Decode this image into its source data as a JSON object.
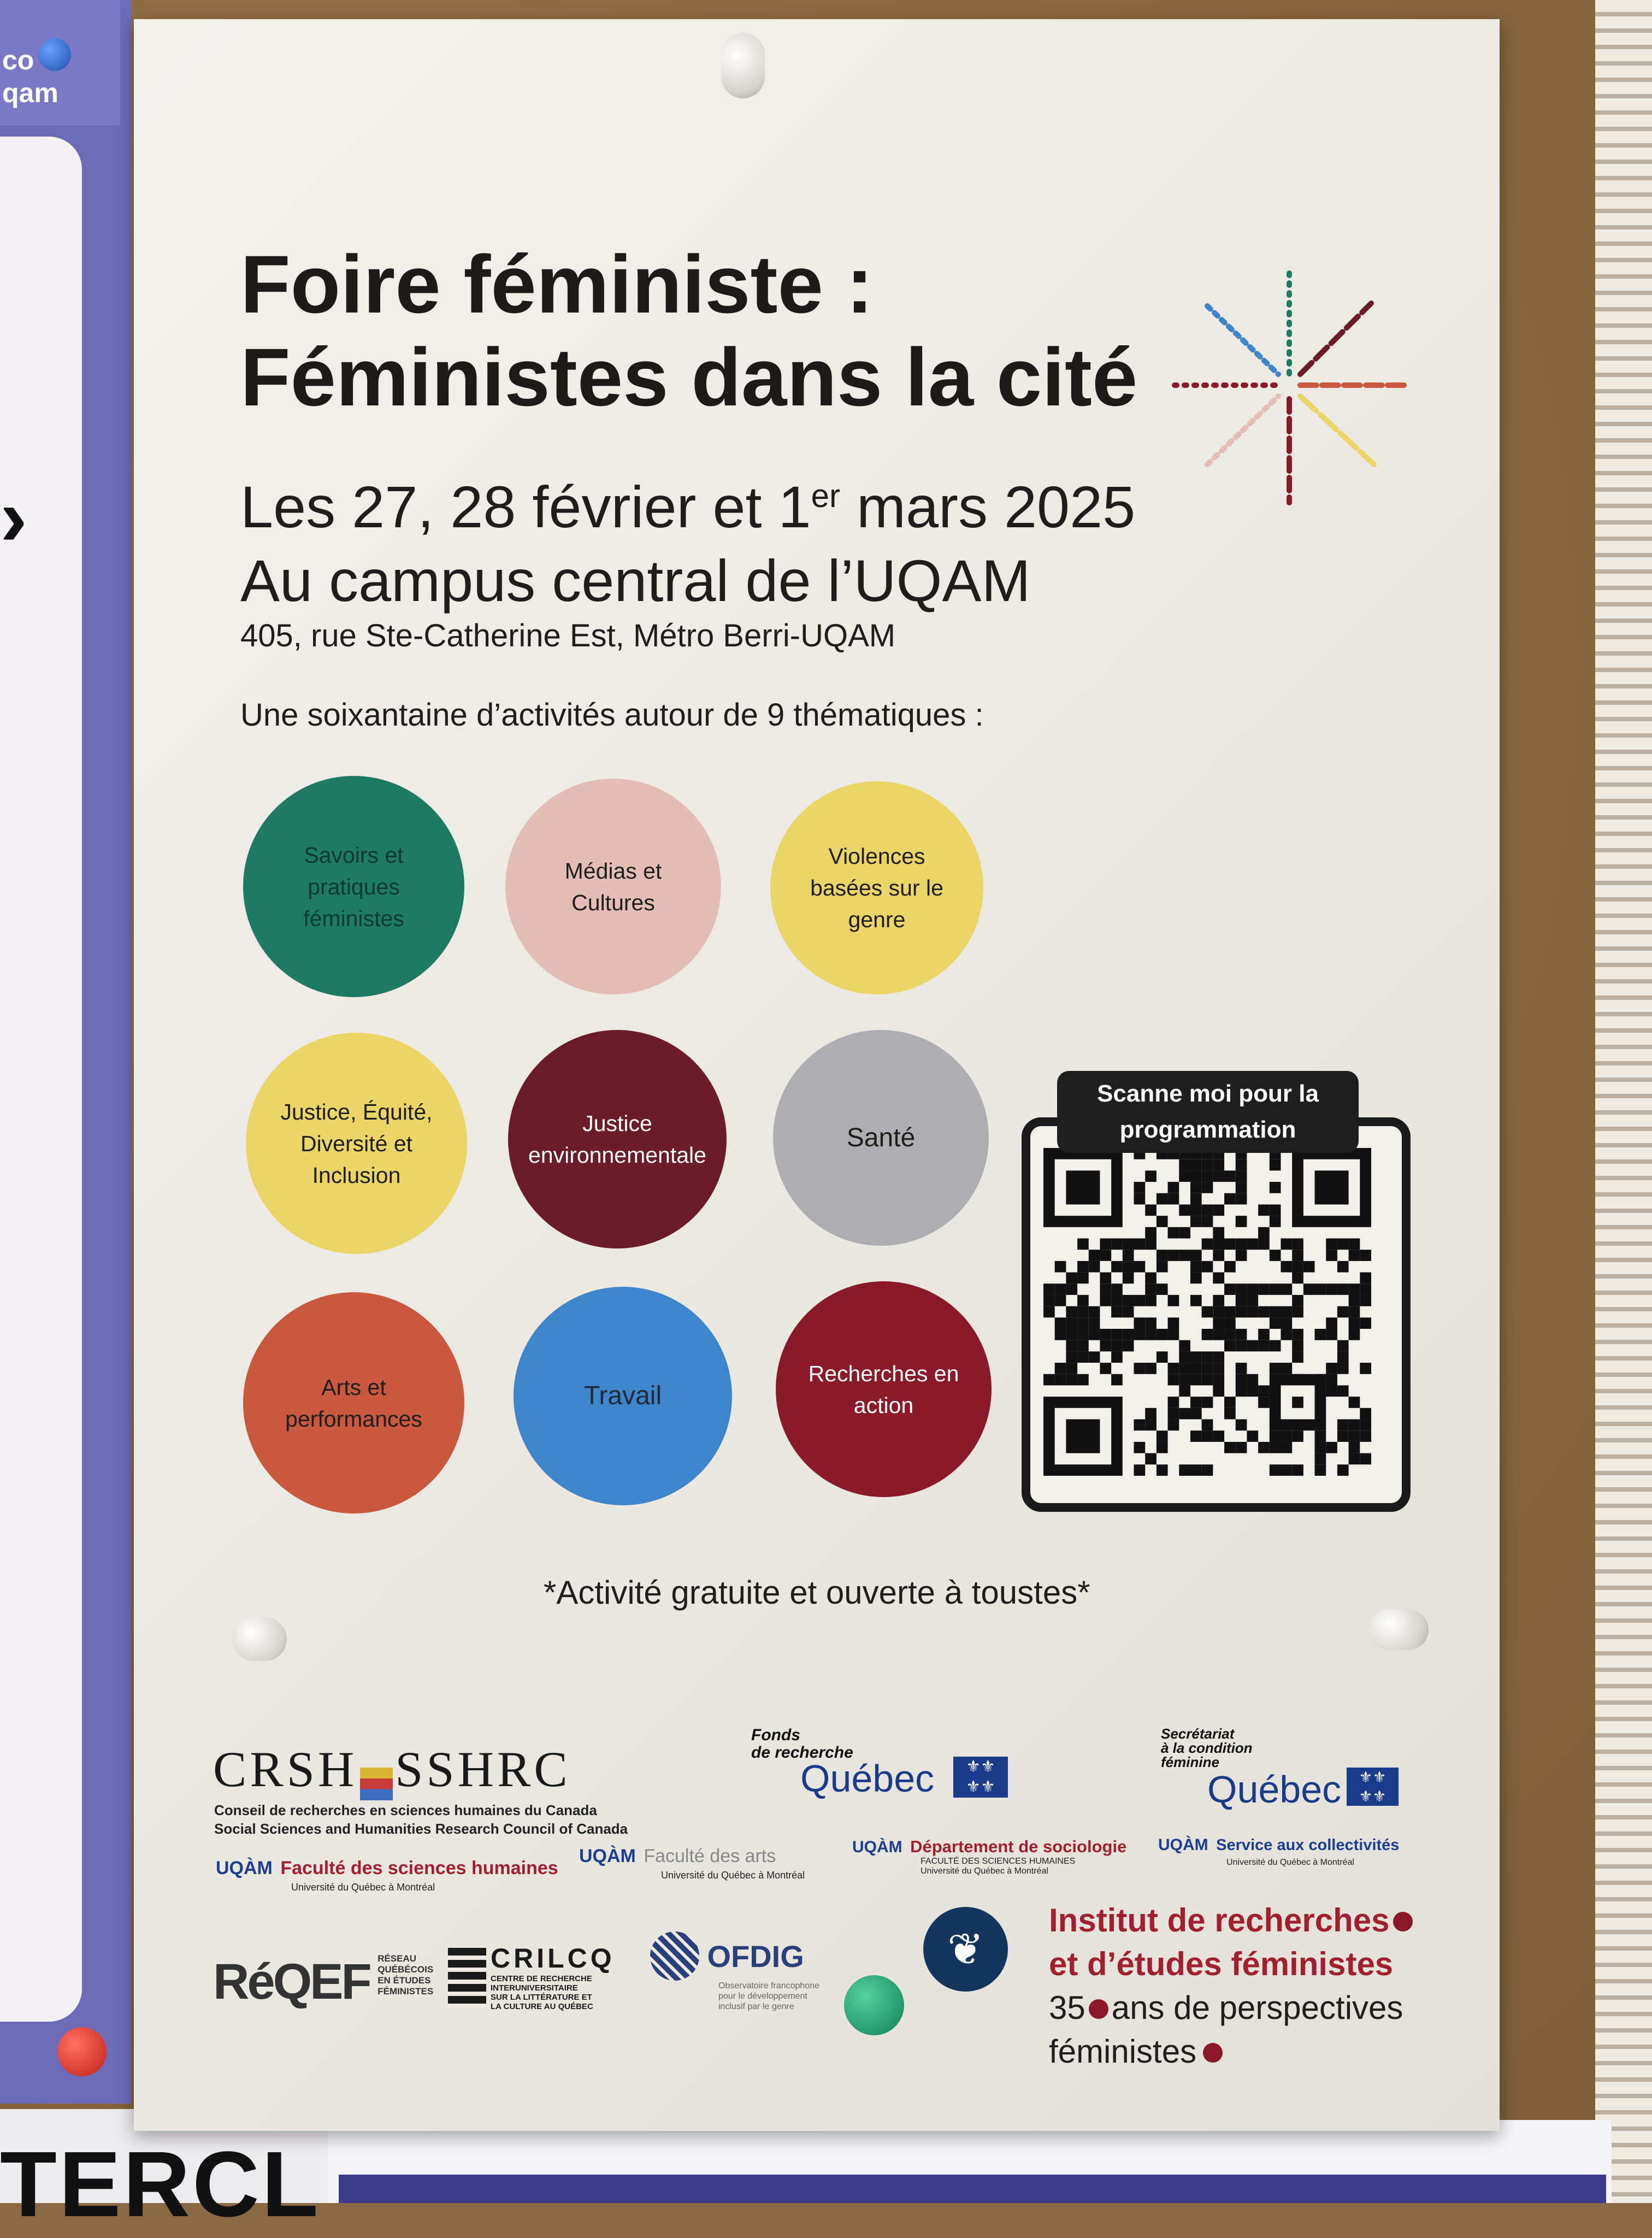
{
  "left_poster": {
    "text": "co\nqam"
  },
  "bottom_poster": {
    "text": "TERCL"
  },
  "poster": {
    "title_line1": "Foire féministe :",
    "title_line2": "Féministes dans la cité",
    "date_prefix": "Les 27, 28 février et 1",
    "date_sup": "er",
    "date_suffix": " mars 2025",
    "campus": "Au campus central de l’UQAM",
    "address": "405, rue Ste-Catherine Est, Métro Berri-UQAM",
    "intro": "Une soixantaine d’activités autour de 9 thématiques :",
    "themes": [
      {
        "label": "Savoirs et pratiques féministes",
        "color": "#1f7a63"
      },
      {
        "label": "Médias et Cultures",
        "color": "#e3bdb6"
      },
      {
        "label": "Violences basées sur le genre",
        "color": "#ead566"
      },
      {
        "label": "Justice, Équité, Diversité et Inclusion",
        "color": "#ead566"
      },
      {
        "label": "Justice environnementale",
        "color": "#6a1c2a"
      },
      {
        "label": "Santé",
        "color": "#aeadb1"
      },
      {
        "label": "Arts et performances",
        "color": "#c9583e"
      },
      {
        "label": "Travail",
        "color": "#3f85cc"
      },
      {
        "label": "Recherches en action",
        "color": "#8a1a2a"
      }
    ],
    "qr_label": "Scanne moi pour la programmation",
    "free_note": "*Activité gratuite et ouverte à toustes*",
    "sponsors": {
      "crsh": "CRSH",
      "sshrc": "SSHRC",
      "crsh_line1": "Conseil de recherches en sciences humaines du Canada",
      "crsh_line2": "Social Sciences and Humanities Research Council of Canada",
      "frq_small": "Fonds\nde recherche",
      "frq_big": "Québec",
      "scf_small": "Secrétariat\nà la condition\nféminine",
      "scf_big": "Québec",
      "uqam": "UQÀM",
      "fsh": "Faculté des sciences humaines",
      "fsh_sub": "Université du Québec à Montréal",
      "arts": "Faculté des arts",
      "arts_sub": "Université du Québec à Montréal",
      "socio": "Département de sociologie",
      "socio_sub": "FACULTÉ DES SCIENCES HUMAINES\nUniversité du Québec à Montréal",
      "collect": "Service aux collectivités",
      "collect_sub": "Université du Québec à Montréal",
      "reqef": "RéQEF",
      "reqef_sub": "RÉSEAU\nQUÉBÉCOIS\nEN ÉTUDES\nFÉMINISTES",
      "crilcq": "CRILCQ",
      "crilcq_sub": "CENTRE DE RECHERCHE\nINTERUNIVERSITAIRE\nSUR LA LITTÉRATURE ET\nLA CULTURE AU QUÉBEC",
      "ofdig": "OFDIG",
      "ofdig_sub": "Observatoire francophone\npour le développement\ninclusif par le genre",
      "iref_line1": "Institut de recherches",
      "iref_line2": "et d’études féministes",
      "iref_line3_a": "35",
      "iref_line3_b": "ans de perspectives",
      "iref_line4": "féministes"
    }
  },
  "colors": {
    "paper": "#eeebe5",
    "cork": "#8b6a42",
    "dark_red": "#8a1a2a"
  }
}
